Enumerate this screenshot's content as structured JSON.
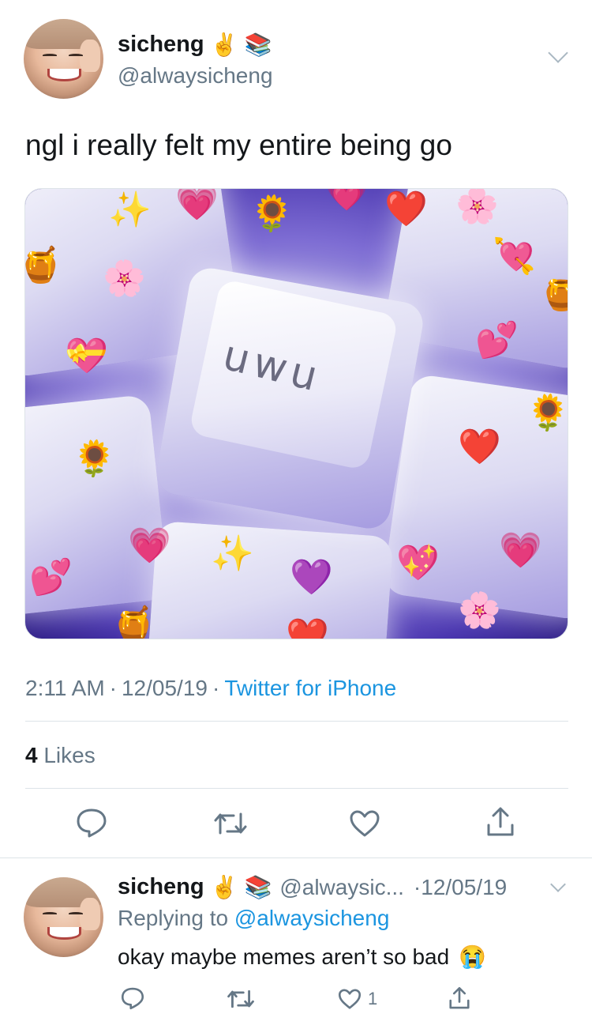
{
  "tweet": {
    "display_name": "sicheng",
    "name_emojis": [
      "✌️",
      "📚"
    ],
    "handle": "@alwaysicheng",
    "text": "ngl i really felt my entire being go",
    "image": {
      "key_label": "uwu",
      "decorations": [
        "💛",
        "💗",
        "🌻",
        "❤️",
        "🌸",
        "💘",
        "🍯",
        "✨",
        "💖",
        "💝",
        "💕",
        "💜"
      ]
    },
    "time": "2:11 AM",
    "date": "12/05/19",
    "separator": "·",
    "source": "Twitter for iPhone",
    "likes_count": "4",
    "likes_label": "Likes",
    "actions": {
      "reply_icon": "reply-icon",
      "retweet_icon": "retweet-icon",
      "like_icon": "heart-icon",
      "share_icon": "share-icon"
    }
  },
  "reply": {
    "display_name": "sicheng",
    "name_emojis": [
      "✌️",
      "📚"
    ],
    "handle": "@alwaysic...",
    "date": "·12/05/19",
    "replying_to_label": "Replying to",
    "replying_to_handle": "@alwaysicheng",
    "text": "okay maybe memes aren’t so bad",
    "text_emoji": "😭",
    "like_count": "1"
  },
  "colors": {
    "link": "#1b95e0",
    "secondary_text": "#657786",
    "primary_text": "#14171a",
    "divider": "#dde3e8"
  }
}
